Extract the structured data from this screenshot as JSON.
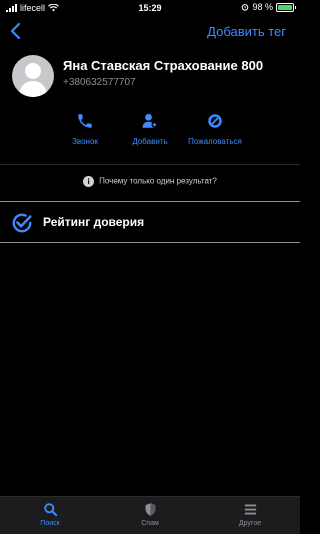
{
  "status_bar": {
    "carrier": "lifecell",
    "time": "15:29",
    "battery_text": "98 %",
    "battery_level": 0.98
  },
  "nav": {
    "add_tag_label": "Добавить тег"
  },
  "contact": {
    "name": "Яна Ставская Страхование 800",
    "phone": "+380632577707"
  },
  "actions": [
    {
      "label": "Звонок",
      "icon": "phone-icon"
    },
    {
      "label": "Добавить",
      "icon": "add-contact-icon"
    },
    {
      "label": "Пожаловаться",
      "icon": "block-icon"
    }
  ],
  "info": {
    "why_text": "Почему только один результат?"
  },
  "trust": {
    "title": "Рейтинг доверия"
  },
  "tabs": [
    {
      "label": "Поиск",
      "icon": "search-icon",
      "active": true
    },
    {
      "label": "Спам",
      "icon": "shield-icon",
      "active": false
    },
    {
      "label": "Другое",
      "icon": "menu-icon",
      "active": false
    }
  ],
  "colors": {
    "accent": "#3d8bff",
    "background": "#000000",
    "secondary_text": "#8e8e93",
    "battery_fill": "#4cd964"
  }
}
